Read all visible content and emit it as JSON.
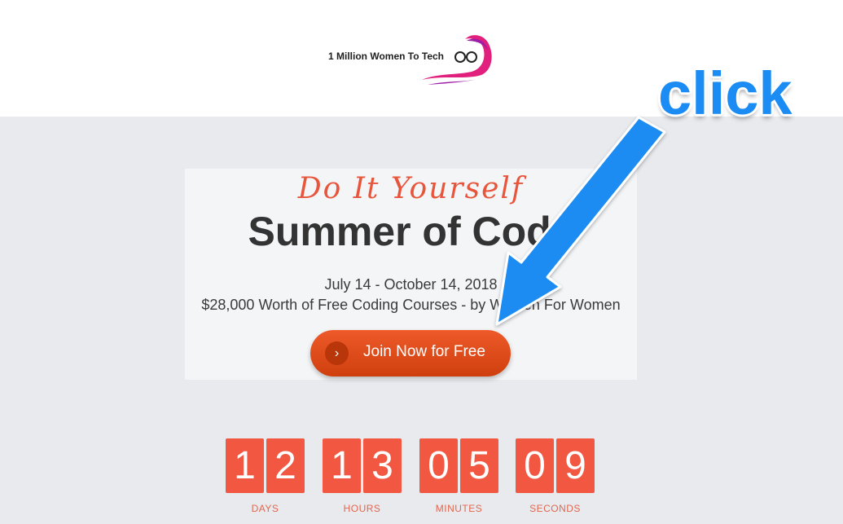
{
  "header": {
    "logo_text": "1 Million Women To Tech"
  },
  "hero": {
    "tagline": "Do It Yourself",
    "title": "Summer of Code",
    "dates": "July 14 - October 14, 2018",
    "subtitle": "$28,000 Worth of Free Coding Courses - by Women For Women",
    "cta_label": "Join Now for Free",
    "cta_icon": "chevron-right-icon"
  },
  "countdown": {
    "units": [
      {
        "digits": [
          "1",
          "2"
        ],
        "label": "DAYS"
      },
      {
        "digits": [
          "1",
          "3"
        ],
        "label": "HOURS"
      },
      {
        "digits": [
          "0",
          "5"
        ],
        "label": "MINUTES"
      },
      {
        "digits": [
          "0",
          "9"
        ],
        "label": "SECONDS"
      }
    ]
  },
  "annotation": {
    "text": "click"
  },
  "colors": {
    "accent": "#f25741",
    "cta": "#e04a1a",
    "annotation": "#1b8cf3",
    "logo_pink": "#e0207c"
  }
}
